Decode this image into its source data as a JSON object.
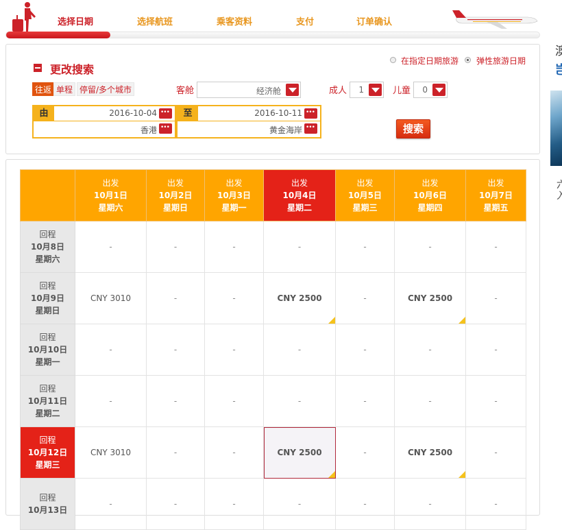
{
  "steps": [
    "选择日期",
    "选择航班",
    "乘客资料",
    "支付",
    "订单确认"
  ],
  "panel": {
    "title": "更改搜索",
    "radio_fixed": "在指定日期旅游",
    "radio_flex": "弹性旅游日期",
    "trip_round": "往返",
    "trip_oneway": "单程",
    "trip_multi": "停留/多个城市",
    "cabin_label": "客舱",
    "cabin_value": "经济舱",
    "adult_label": "成人",
    "adult_value": "1",
    "child_label": "儿童",
    "child_value": "0",
    "from_tag": "由",
    "to_tag": "至",
    "depart_date": "2016-10-04",
    "return_date": "2016-10-11",
    "origin": "香港",
    "destination": "黄金海岸",
    "search_label": "搜索"
  },
  "grid": {
    "depart_cols": [
      {
        "kind": "出发",
        "date": "10月1日",
        "weekday": "星期六"
      },
      {
        "kind": "出发",
        "date": "10月2日",
        "weekday": "星期日"
      },
      {
        "kind": "出发",
        "date": "10月3日",
        "weekday": "星期一"
      },
      {
        "kind": "出发",
        "date": "10月4日",
        "weekday": "星期二"
      },
      {
        "kind": "出发",
        "date": "10月5日",
        "weekday": "星期三"
      },
      {
        "kind": "出发",
        "date": "10月6日",
        "weekday": "星期四"
      },
      {
        "kind": "出发",
        "date": "10月7日",
        "weekday": "星期五"
      }
    ],
    "rows": [
      {
        "kind": "回程",
        "date": "10月8日",
        "weekday": "星期六",
        "cells": [
          "-",
          "-",
          "-",
          "-",
          "-",
          "-",
          "-"
        ]
      },
      {
        "kind": "回程",
        "date": "10月9日",
        "weekday": "星期日",
        "cells": [
          "CNY 3010",
          "-",
          "-",
          "CNY 2500",
          "-",
          "CNY 2500",
          "-"
        ]
      },
      {
        "kind": "回程",
        "date": "10月10日",
        "weekday": "星期一",
        "cells": [
          "-",
          "-",
          "-",
          "-",
          "-",
          "-",
          "-"
        ]
      },
      {
        "kind": "回程",
        "date": "10月11日",
        "weekday": "星期二",
        "cells": [
          "-",
          "-",
          "-",
          "-",
          "-",
          "-",
          "-"
        ]
      },
      {
        "kind": "回程",
        "date": "10月12日",
        "weekday": "星期三",
        "cells": [
          "CNY 3010",
          "-",
          "-",
          "CNY 2500",
          "-",
          "CNY 2500",
          "-"
        ]
      },
      {
        "kind": "回程",
        "date": "10月13日",
        "weekday": "",
        "cells": [
          "-",
          "-",
          "-",
          "-",
          "-",
          "-",
          "-"
        ]
      }
    ]
  },
  "side": {
    "t1": "澳",
    "t2": "岂",
    "t3": "六\n入"
  },
  "colors": {
    "brand_red": "#cc2229",
    "accent_orange": "#ffa500",
    "selected_red": "#e42218",
    "low_fare_marker": "#f5c21c"
  }
}
